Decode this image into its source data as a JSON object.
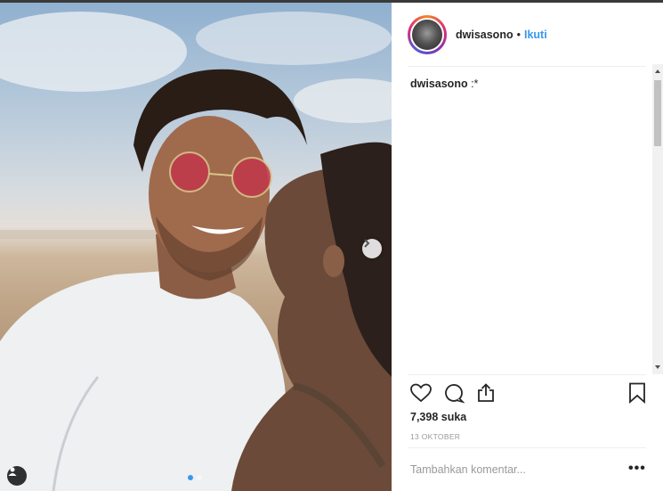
{
  "post": {
    "username": "dwisasono",
    "separator": "•",
    "follow_label": "Ikuti",
    "caption_username": "dwisasono",
    "caption_text": ":*",
    "likes": "7,398 suka",
    "date": "13 OKTOBER",
    "comment_placeholder": "Tambahkan komentar...",
    "more_label": "•••"
  },
  "carousel": {
    "total_slides": 2,
    "active_slide": 1
  },
  "icons": {
    "next": "chevron-right-icon",
    "tag": "user-tag-icon",
    "like": "heart-icon",
    "comment": "comment-icon",
    "share": "share-icon",
    "save": "bookmark-icon"
  },
  "colors": {
    "accent": "#3897f0",
    "text": "#262626",
    "muted": "#999999"
  }
}
